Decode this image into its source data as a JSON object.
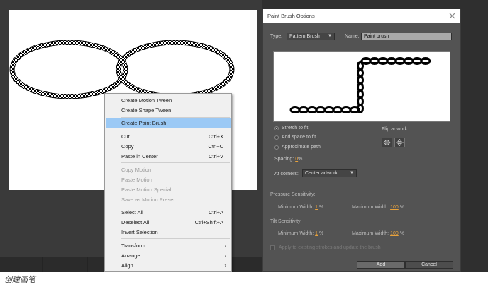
{
  "context_menu": {
    "items": [
      {
        "label": "Create Motion Tween",
        "shortcut": "",
        "disabled": false
      },
      {
        "label": "Create Shape Tween",
        "shortcut": "",
        "disabled": false
      },
      {
        "label": "Create Paint Brush",
        "shortcut": "",
        "disabled": false,
        "highlighted": true
      },
      {
        "label": "Cut",
        "shortcut": "Ctrl+X",
        "disabled": false
      },
      {
        "label": "Copy",
        "shortcut": "Ctrl+C",
        "disabled": false
      },
      {
        "label": "Paste in Center",
        "shortcut": "Ctrl+V",
        "disabled": false
      },
      {
        "label": "Copy Motion",
        "shortcut": "",
        "disabled": true
      },
      {
        "label": "Paste Motion",
        "shortcut": "",
        "disabled": true
      },
      {
        "label": "Paste Motion Special...",
        "shortcut": "",
        "disabled": true
      },
      {
        "label": "Save as Motion Preset...",
        "shortcut": "",
        "disabled": true
      },
      {
        "label": "Select All",
        "shortcut": "Ctrl+A",
        "disabled": false
      },
      {
        "label": "Deselect All",
        "shortcut": "Ctrl+Shift+A",
        "disabled": false
      },
      {
        "label": "Invert Selection",
        "shortcut": "",
        "disabled": false
      },
      {
        "label": "Transform",
        "shortcut": "",
        "disabled": false,
        "submenu": true
      },
      {
        "label": "Arrange",
        "shortcut": "",
        "disabled": false,
        "submenu": true
      },
      {
        "label": "Align",
        "shortcut": "",
        "disabled": false,
        "submenu": true
      }
    ],
    "submenu_glyph": "›"
  },
  "dialog": {
    "title": "Paint Brush Options",
    "type_label": "Type:",
    "type_value": "Pattern Brush",
    "name_label": "Name:",
    "name_value": "Paint brush",
    "options": {
      "stretch": "Stretch to fit",
      "add_space": "Add space to fit",
      "approximate": "Approximate path"
    },
    "selected_option": "stretch",
    "flip_label": "Flip artwork:",
    "spacing_label": "Spacing:",
    "spacing_value": "0",
    "spacing_unit": "%",
    "corners_label": "At corners:",
    "corners_value": "Center artwork",
    "pressure_label": "Pressure Sensitivity:",
    "tilt_label": "Tilt Sensitivity:",
    "min_width_label": "Minimum Width:",
    "max_width_label": "Maximum Width:",
    "pressure_min": "1",
    "pressure_max": "100",
    "tilt_min": "1",
    "tilt_max": "100",
    "percent": "%",
    "apply_label": "Apply to existing strokes and update the brush",
    "add_button": "Add",
    "cancel_button": "Cancel"
  },
  "caption": "创建画笔",
  "colors": {
    "highlight": "#9bc9f5",
    "accent_value": "#e8a23c"
  }
}
